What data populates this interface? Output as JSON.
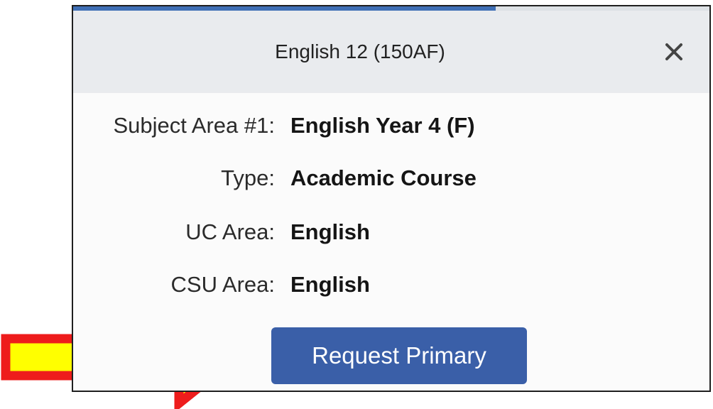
{
  "modal": {
    "title": "English 12 (150AF)",
    "close_icon": "close-icon",
    "close_glyph": "×",
    "accent_color": "#3a5fa8"
  },
  "details": [
    {
      "label": "Subject Area #1:",
      "value": "English Year 4 (F)"
    },
    {
      "label": "Type:",
      "value": "Academic Course"
    },
    {
      "label": "UC Area:",
      "value": "English"
    },
    {
      "label": "CSU Area:",
      "value": "English"
    }
  ],
  "actions": {
    "request_primary_label": "Request Primary"
  },
  "annotation": {
    "arrow_icon": "arrow-right-icon",
    "fill_color": "#ffff00",
    "stroke_color": "#ee1c1c"
  }
}
